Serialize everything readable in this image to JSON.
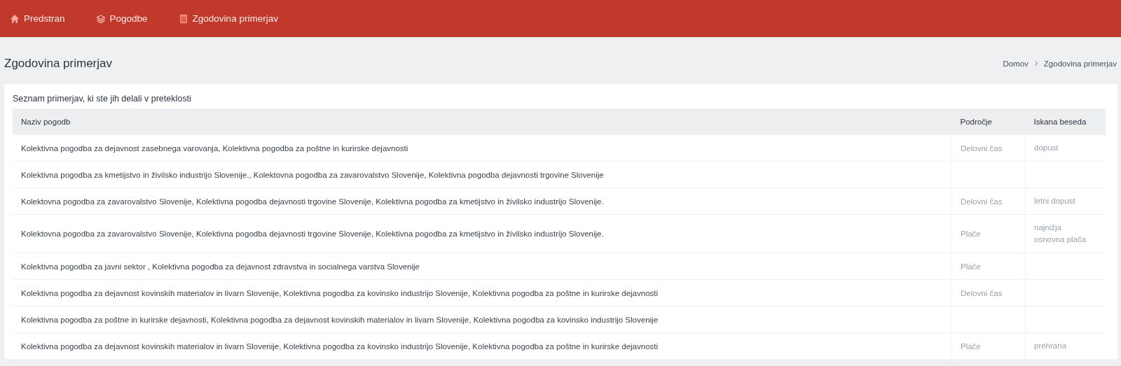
{
  "nav": [
    {
      "kind": "home",
      "label": "Predstran"
    },
    {
      "kind": "layers",
      "label": "Pogodbe"
    },
    {
      "kind": "document",
      "label": "Zgodovina primerjav"
    }
  ],
  "page_title": "Zgodovina primerjav",
  "breadcrumb": [
    "Domov",
    "Zgodovina primerjav"
  ],
  "card_title": "Seznam primerjav, ki ste jih delali v preteklosti",
  "table": {
    "columns": [
      "Naziv pogodb",
      "Področje",
      "Iskana beseda"
    ],
    "rows": [
      {
        "name": "Kolektivna pogodba za dejavnost zasebnega varovanja, Kolektivna pogodba za poštne in kurirske dejavnosti",
        "area": "Delovni čas",
        "keyword": [
          "dopust"
        ]
      },
      {
        "name": "Kolektivna pogodba za kmetijstvo in živilsko industrijo Slovenije., Kolektovna pogodba za zavarovalstvo Slovenije, Kolektivna pogodba dejavnosti trgovine Slovenije"
      },
      {
        "name": "Kolektovna pogodba za zavarovalstvo Slovenije, Kolektivna pogodba dejavnosti trgovine Slovenije, Kolektivna pogodba za kmetijstvo in živilsko industrijo Slovenije.",
        "area": "Delovni čas",
        "keyword": [
          "letni dopust"
        ]
      },
      {
        "name": "Kolektovna pogodba za zavarovalstvo Slovenije, Kolektivna pogodba dejavnosti trgovine Slovenije, Kolektivna pogodba za kmetijstvo in živilsko industrijo Slovenije.",
        "area": "Plače",
        "keyword": [
          "najnižja",
          "osnovna plača"
        ]
      },
      {
        "name": "Kolektivna pogodba za javni sektor , Kolektivna pogodba za dejavnost zdravstva in socialnega varstva Slovenije",
        "area": "Plače"
      },
      {
        "name": "Kolektivna pogodba za dejavnost kovinskih materialov in livarn Slovenije, Kolektivna pogodba za kovinsko industrijo Slovenije, Kolektivna pogodba za poštne in kurirske dejavnosti",
        "area": "Delovni čas"
      },
      {
        "name": "Kolektivna pogodba za poštne in kurirske dejavnosti, Kolektivna pogodba za dejavnost kovinskih materialov in livarn Slovenije, Kolektivna pogodba za kovinsko industrijo Slovenije"
      },
      {
        "name": "Kolektivna pogodba za dejavnost kovinskih materialov in livarn Slovenije, Kolektivna pogodba za kovinsko industrijo Slovenije, Kolektivna pogodba za poštne in kurirske dejavnosti",
        "area": "Plače",
        "keyword": [
          "prehrana"
        ]
      }
    ]
  }
}
